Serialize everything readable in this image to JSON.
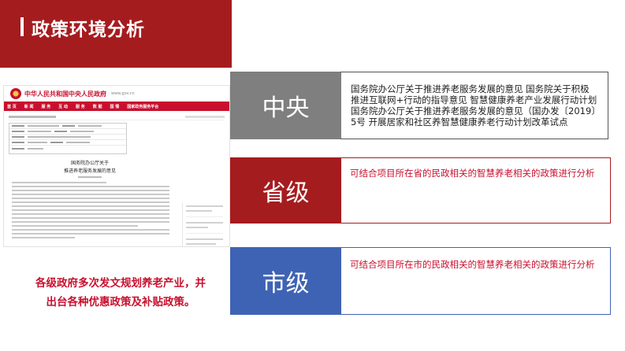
{
  "header": {
    "title": "政策环境分析",
    "accent_color": "#a51c1f"
  },
  "document_screenshot": {
    "site_title": "中华人民共和国中央人民政府",
    "site_url": "www.gov.cn",
    "nav": [
      "首 页",
      "新 闻",
      "服 务",
      "互 动",
      "服 务",
      "数 据",
      "国 情",
      "国家政务服务平台"
    ],
    "title_line1": "国务院办公厅关于",
    "title_line2": "推进养老服务发展的意见"
  },
  "summary": {
    "line1": "各级政府多次发文规划养老产业，并",
    "line2": "出台各种优惠政策及补贴政策。"
  },
  "levels": {
    "central": {
      "label": "中央",
      "color": "#7f7f7f",
      "lines": [
        "国务院办公厅关于推进养老服务发展的意见 国务院关于积极",
        "推进互联网+行动的指导意见 智慧健康养老产业发展行动计划",
        "国务院办公厅关于推进养老服务发展的意见（国办发〔2019〕",
        "5号 开展居家和社区养智慧健康养老行动计划改革试点"
      ]
    },
    "province": {
      "label": "省级",
      "color": "#a51c1f",
      "text": "可结合项目所在省的民政相关的智慧养老相关的政策进行分析"
    },
    "city": {
      "label": "市级",
      "color": "#3f63b4",
      "text": "可结合项目所在市的民政相关的智慧养老相关的政策进行分析"
    }
  }
}
